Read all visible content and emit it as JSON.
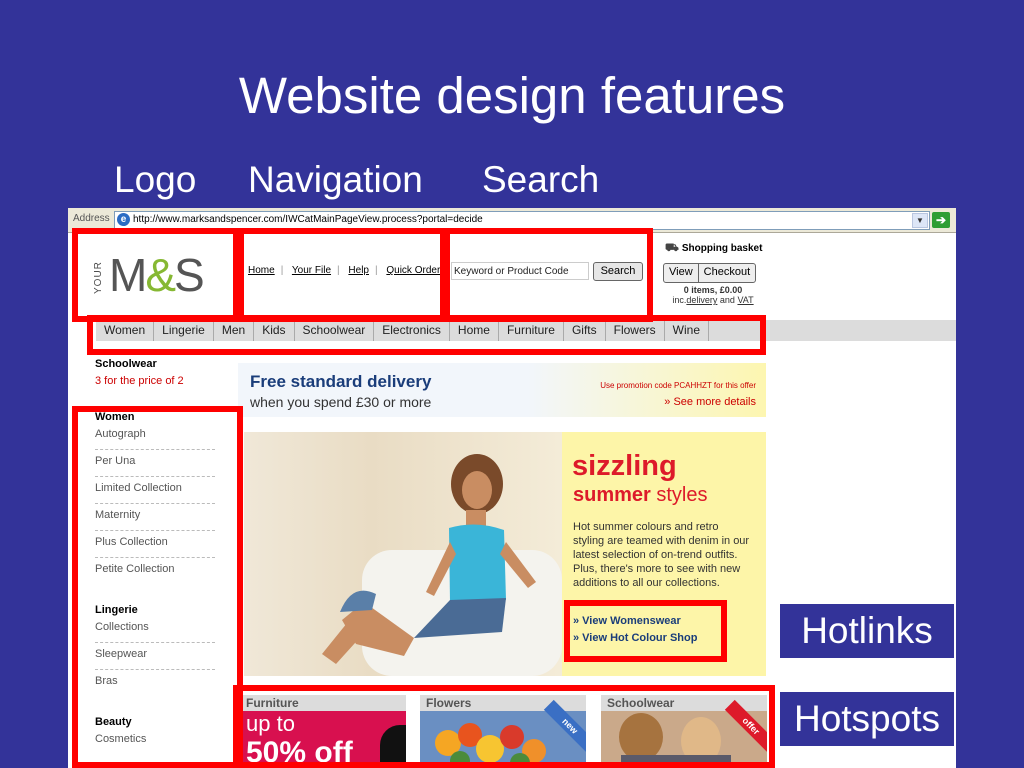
{
  "slide": {
    "title": "Website design features",
    "captions": [
      "Logo",
      "Navigation",
      "Search"
    ],
    "labels": [
      "Hotlinks",
      "Hotspots"
    ],
    "highlight_color": "#ff0000"
  },
  "browser": {
    "address_label": "Address",
    "url": "http://www.marksandspencer.com/IWCatMainPageView.process?portal=decide",
    "icons": [
      "ie-page-icon",
      "dropdown-arrow-icon",
      "go-arrow-icon"
    ]
  },
  "site": {
    "logo": {
      "your": "YOUR",
      "m": "M",
      "amp": "&",
      "s": "S"
    },
    "top_links": [
      "Home",
      "Your File",
      "Help",
      "Quick Order"
    ],
    "search": {
      "placeholder": "Keyword or Product Code",
      "button": "Search"
    },
    "basket": {
      "title": "Shopping basket",
      "view": "View",
      "checkout": "Checkout",
      "items": "0 items, £0.00",
      "inc": "inc.",
      "delivery": "delivery",
      "and": "and",
      "vat": "VAT"
    },
    "nav": [
      "Women",
      "Lingerie",
      "Men",
      "Kids",
      "Schoolwear",
      "Electronics",
      "Home",
      "Furniture",
      "Gifts",
      "Flowers",
      "Wine"
    ],
    "sidebar": {
      "schoolwear": {
        "title": "Schoolwear",
        "promo": "3 for the price of 2"
      },
      "groups": [
        {
          "title": "Women",
          "items": [
            "Autograph",
            "Per Una",
            "Limited Collection",
            "Maternity",
            "Plus Collection",
            "Petite Collection"
          ]
        },
        {
          "title": "Lingerie",
          "items": [
            "Collections",
            "Sleepwear",
            "Bras"
          ]
        },
        {
          "title": "Beauty",
          "items": [
            "Cosmetics"
          ]
        }
      ]
    },
    "delivery": {
      "line1": "Free standard delivery",
      "line2": "when you spend £30 or more",
      "promo": "Use promotion code PCAHHZT for this offer",
      "more": "» See more details"
    },
    "hero": {
      "line1": "sizzling",
      "line2_bold": "summer",
      "line2_rest": " styles",
      "body": "Hot summer colours and retro styling are teamed with denim in our latest selection of on-trend outfits. Plus, there's more to see with new additions to all our collections.",
      "links": [
        "» View Womenswear",
        "» View Hot Colour Shop"
      ]
    },
    "tiles": [
      {
        "title": "Furniture",
        "line1": "up to",
        "line2": "50% off"
      },
      {
        "title": "Flowers",
        "badge": "new"
      },
      {
        "title": "Schoolwear",
        "badge": "offer"
      }
    ]
  }
}
